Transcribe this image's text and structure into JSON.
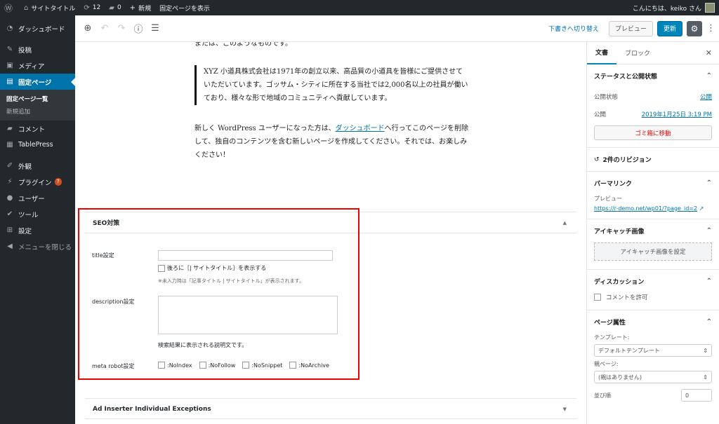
{
  "adminbar": {
    "site": "サイトタイトル",
    "updates": "12",
    "comments": "0",
    "new": "新規",
    "view": "固定ページを表示",
    "greeting": "こんにちは、keiko さん"
  },
  "sidebar": {
    "items": [
      {
        "label": "ダッシュボード",
        "icon": "dashboard-icon"
      },
      {
        "label": "投稿",
        "icon": "pin-icon"
      },
      {
        "label": "メディア",
        "icon": "media-icon"
      },
      {
        "label": "固定ページ",
        "icon": "page-icon"
      },
      {
        "label": "コメント",
        "icon": "comment-icon"
      },
      {
        "label": "TablePress",
        "icon": "table-icon"
      },
      {
        "label": "外観",
        "icon": "brush-icon"
      },
      {
        "label": "プラグイン",
        "icon": "plugin-icon",
        "badge": "7"
      },
      {
        "label": "ユーザー",
        "icon": "user-icon"
      },
      {
        "label": "ツール",
        "icon": "wrench-icon"
      },
      {
        "label": "設定",
        "icon": "settings-icon"
      },
      {
        "label": "メニューを閉じる",
        "icon": "collapse-icon"
      }
    ],
    "submenu": [
      "固定ページ一覧",
      "新規追加"
    ]
  },
  "toolbar": {
    "switch_draft": "下書きへ切り替え",
    "preview": "プレビュー",
    "update": "更新"
  },
  "content": {
    "p1": "または、このようなものです。",
    "quote": "XYZ 小道具株式会社は1971年の創立以来、高品質の小道具を皆様にご提供させていただいています。ゴッサム・シティに所在する当社では2,000名以上の社員が働いており、様々な形で地域のコミュニティへ貢献しています。",
    "p2_before": "新しく WordPress ユーザーになった方は、",
    "p2_link": "ダッシュボード",
    "p2_after": "へ行ってこのページを削除して、独自のコンテンツを含む新しいページを作成してください。それでは、お楽しみください！"
  },
  "seo": {
    "title": "SEO対策",
    "title_label": "title設定",
    "title_value": "",
    "append_label": "後ろに［| サイトタイトル］を表示する",
    "title_hint": "※未入力時は「記事タイトル | サイトタイトル」が表示されます。",
    "desc_label": "description設定",
    "desc_hint": "検索結果に表示される説明文です。",
    "robot_label": "meta robot設定",
    "robots": [
      ":NoIndex",
      ":NoFollow",
      ":NoSnippet",
      ":NoArchive"
    ]
  },
  "adinserter": {
    "title": "Ad Inserter Individual Exceptions"
  },
  "panel": {
    "tab_doc": "文書",
    "tab_block": "ブロック",
    "status_title": "ステータスと公開状態",
    "visibility_label": "公開状態",
    "visibility_value": "公開",
    "publish_label": "公開",
    "publish_value": "2019年1月25日 3:19 PM",
    "trash": "ゴミ箱に移動",
    "revisions": "2件のリビジョン",
    "permalink_title": "パーマリンク",
    "permalink_label": "プレビュー",
    "permalink_url": "https://r-demo.net/wp01/?page_id=2",
    "featured_title": "アイキャッチ画像",
    "featured_btn": "アイキャッチ画像を設定",
    "discussion_title": "ディスカッション",
    "allow_comments": "コメントを許可",
    "page_attr_title": "ページ属性",
    "template_label": "テンプレート:",
    "template_value": "デフォルトテンプレート",
    "parent_label": "親ページ:",
    "parent_value": "(親はありません)",
    "order_label": "並び順",
    "order_value": "0"
  }
}
